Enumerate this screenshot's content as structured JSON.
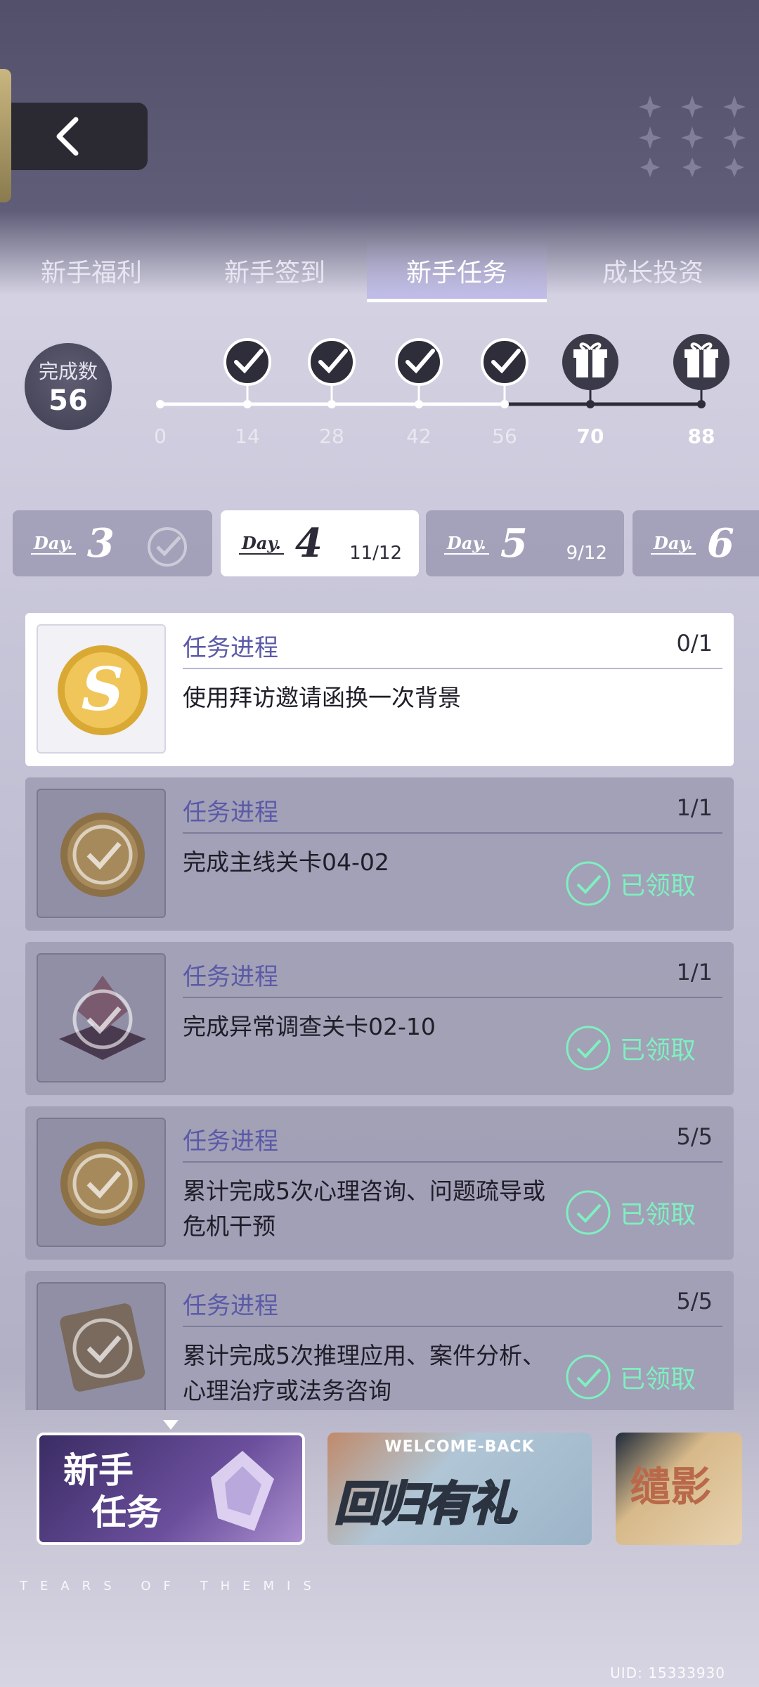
{
  "tabs": [
    {
      "label": "新手福利",
      "active": false
    },
    {
      "label": "新手签到",
      "active": false
    },
    {
      "label": "新手任务",
      "active": true
    },
    {
      "label": "成长投资",
      "active": false
    }
  ],
  "progress": {
    "count_label": "完成数",
    "count_value": "56",
    "milestones": [
      {
        "value": "0",
        "state": "start"
      },
      {
        "value": "14",
        "state": "claimed"
      },
      {
        "value": "28",
        "state": "claimed"
      },
      {
        "value": "42",
        "state": "claimed"
      },
      {
        "value": "56",
        "state": "claimed"
      },
      {
        "value": "70",
        "state": "gift"
      },
      {
        "value": "88",
        "state": "gift"
      }
    ]
  },
  "days": [
    {
      "word": "Day.",
      "num": "3",
      "progress": "",
      "state": "done"
    },
    {
      "word": "Day.",
      "num": "4",
      "progress": "11/12",
      "state": "active"
    },
    {
      "word": "Day.",
      "num": "5",
      "progress": "9/12",
      "state": "normal"
    },
    {
      "word": "Day.",
      "num": "6",
      "progress": "",
      "state": "normal"
    }
  ],
  "tasks": [
    {
      "label": "任务进程",
      "progress": "0/1",
      "desc": "使用拜访邀请函换一次背景",
      "status": "",
      "icon": "gold-coin-icon"
    },
    {
      "label": "任务进程",
      "progress": "1/1",
      "desc": "完成主线关卡04-02",
      "status": "已领取",
      "icon": "gold-coin-icon"
    },
    {
      "label": "任务进程",
      "progress": "1/1",
      "desc": "完成异常调查关卡02-10",
      "status": "已领取",
      "icon": "crystal-item-icon"
    },
    {
      "label": "任务进程",
      "progress": "5/5",
      "desc": "累计完成5次心理咨询、问题疏导或危机干预",
      "status": "已领取",
      "icon": "gold-coin-icon"
    },
    {
      "label": "任务进程",
      "progress": "5/5",
      "desc": "累计完成5次推理应用、案件分析、心理治疗或法务咨询",
      "status": "已领取",
      "icon": "box-item-icon"
    }
  ],
  "banners": [
    {
      "title_line1": "新手",
      "title_line2": "任务"
    },
    {
      "top": "WELCOME-BACK",
      "title": "回归有礼"
    },
    {
      "title": "缱影"
    }
  ],
  "footer": {
    "brand": "TEARS OF THEMIS",
    "uid": "UID: 15333930"
  },
  "colors": {
    "accent_claimed": "#7ff0c0",
    "label_purple": "#5b5aa8",
    "active_tab_glow": "#aaa5eb"
  }
}
